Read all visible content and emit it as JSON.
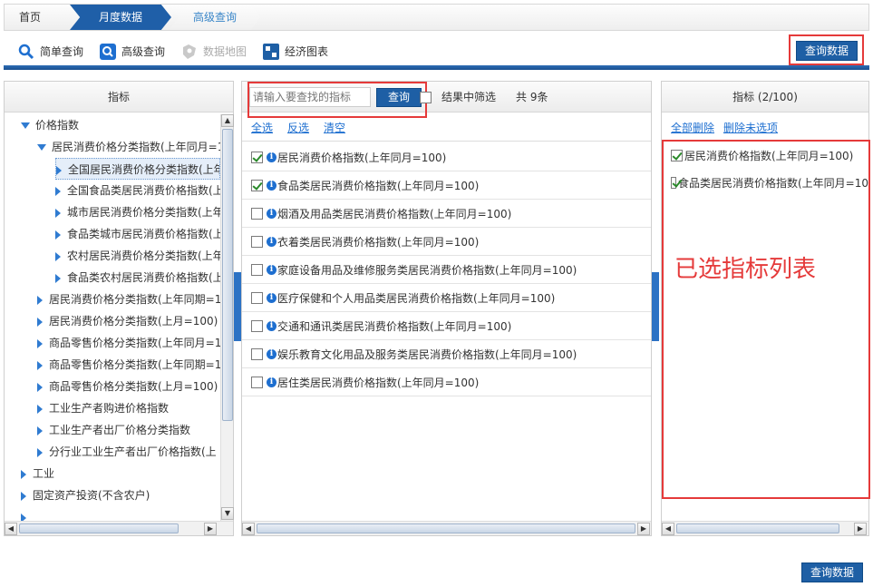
{
  "breadcrumb": {
    "home": "首页",
    "month": "月度数据",
    "advanced": "高级查询"
  },
  "toolbar": {
    "simple": "简单查询",
    "advanced": "高级查询",
    "map": "数据地图",
    "chart": "经济图表",
    "query_btn": "查询数据"
  },
  "left": {
    "header": "指标",
    "tree": [
      {
        "label": "价格指数",
        "expanded": true,
        "level": 0
      },
      {
        "label": "居民消费价格分类指数(上年同月=1",
        "expanded": true,
        "level": 1
      },
      {
        "label": "全国居民消费价格分类指数(上年",
        "level": 2,
        "selected": true
      },
      {
        "label": "全国食品类居民消费价格指数(上",
        "level": 2
      },
      {
        "label": "城市居民消费价格分类指数(上年",
        "level": 2
      },
      {
        "label": "食品类城市居民消费价格指数(上",
        "level": 2
      },
      {
        "label": "农村居民消费价格分类指数(上年",
        "level": 2
      },
      {
        "label": "食品类农村居民消费价格指数(上",
        "level": 2
      },
      {
        "label": "居民消费价格分类指数(上年同期=1",
        "level": 1
      },
      {
        "label": "居民消费价格分类指数(上月=100)",
        "level": 1
      },
      {
        "label": "商品零售价格分类指数(上年同月=1",
        "level": 1
      },
      {
        "label": "商品零售价格分类指数(上年同期=1",
        "level": 1
      },
      {
        "label": "商品零售价格分类指数(上月=100)",
        "level": 1
      },
      {
        "label": "工业生产者购进价格指数",
        "level": 1
      },
      {
        "label": "工业生产者出厂价格分类指数",
        "level": 1
      },
      {
        "label": "分行业工业生产者出厂价格指数(上",
        "level": 1
      },
      {
        "label": "工业",
        "level": 0
      },
      {
        "label": "固定资产投资(不含农户)",
        "level": 0
      },
      {
        "label": "",
        "level": 0
      }
    ]
  },
  "middle": {
    "search_placeholder": "请输入要查找的指标",
    "search_btn": "查询",
    "filter_label": "结果中筛选",
    "count": "共 9条",
    "select_all": "全选",
    "invert": "反选",
    "clear": "清空",
    "items": [
      {
        "label": "居民消费价格指数(上年同月=100)",
        "checked": true
      },
      {
        "label": "食品类居民消费价格指数(上年同月=100)",
        "checked": true
      },
      {
        "label": "烟酒及用品类居民消费价格指数(上年同月=100)",
        "checked": false
      },
      {
        "label": "衣着类居民消费价格指数(上年同月=100)",
        "checked": false
      },
      {
        "label": "家庭设备用品及维修服务类居民消费价格指数(上年同月=100)",
        "checked": false
      },
      {
        "label": "医疗保健和个人用品类居民消费价格指数(上年同月=100)",
        "checked": false
      },
      {
        "label": "交通和通讯类居民消费价格指数(上年同月=100)",
        "checked": false
      },
      {
        "label": "娱乐教育文化用品及服务类居民消费价格指数(上年同月=100)",
        "checked": false
      },
      {
        "label": "居住类居民消费价格指数(上年同月=100)",
        "checked": false
      }
    ]
  },
  "right": {
    "header": "指标 (2/100)",
    "delete_all": "全部删除",
    "delete_unchecked": "删除未选项",
    "items": [
      {
        "label": "居民消费价格指数(上年同月=100)"
      },
      {
        "label": "食品类居民消费价格指数(上年同月=10"
      }
    ],
    "annotation": "已选指标列表"
  },
  "footer": {
    "query_btn": "查询数据"
  },
  "colors": {
    "primary": "#1e5fa5",
    "highlight_box": "#e53a3a",
    "link": "#1e6fd0"
  }
}
